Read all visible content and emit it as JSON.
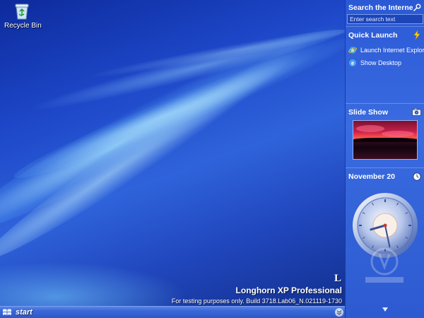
{
  "desktop": {
    "icons": [
      {
        "label": "Recycle Bin",
        "icon": "recycle-bin-icon"
      }
    ],
    "watermark": {
      "logo": "L",
      "edition": "Longhorn XP Professional",
      "build": "For testing purposes only. Build 3718.Lab06_N.021119-1730"
    }
  },
  "sidebar": {
    "search": {
      "title": "Search the Interne",
      "placeholder": "Enter search text",
      "icon": "magnifier-pen-icon"
    },
    "quick_launch": {
      "title": "Quick Launch",
      "icon": "lightning-icon",
      "items": [
        {
          "label": "Launch Internet Explore",
          "icon": "internet-explorer-icon"
        },
        {
          "label": "Show Desktop",
          "icon": "show-desktop-icon"
        }
      ]
    },
    "slide_show": {
      "title": "Slide Show",
      "icon": "camera-icon",
      "photo": "sunset-photo"
    },
    "clock": {
      "title": "November 20",
      "icon": "clock-icon",
      "hour": 8,
      "minute": 28
    }
  },
  "taskbar": {
    "start_label": "start"
  },
  "colors": {
    "accent": "#2b59d6",
    "taskbar": "#3b68d8",
    "desktop": "#1d47c8"
  }
}
